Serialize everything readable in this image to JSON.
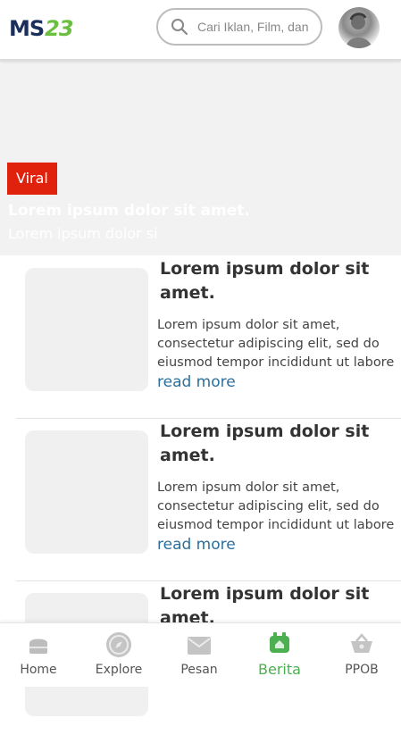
{
  "header": {
    "logo_text_ms": "MS",
    "logo_text_num": "23",
    "search_placeholder": "Cari Iklan, Film, dan"
  },
  "hero": {
    "badge": "Viral",
    "title": "Lorem ipsum dolor sit amet.",
    "subtitle": "Lorem ipsum dolor si"
  },
  "news": [
    {
      "title": "Lorem ipsum dolor sit amet.",
      "body": "Lorem ipsum dolor sit amet, consectetur adipiscing elit, sed do eiusmod tempor incididunt ut labore",
      "link": "read more"
    },
    {
      "title": "Lorem ipsum dolor sit amet.",
      "body": "Lorem ipsum dolor sit amet, consectetur adipiscing elit, sed do eiusmod tempor incididunt ut labore",
      "link": "read more"
    },
    {
      "title": "Lorem ipsum dolor sit amet.",
      "body": "",
      "link": ""
    }
  ],
  "nav": {
    "items": [
      {
        "label": "Home",
        "icon": "home-icon"
      },
      {
        "label": "Explore",
        "icon": "compass-icon"
      },
      {
        "label": "Pesan",
        "icon": "mail-icon"
      },
      {
        "label": "Berita",
        "icon": "news-icon"
      },
      {
        "label": "PPOB",
        "icon": "basket-icon"
      }
    ],
    "active": "Berita",
    "active_color": "#4caf50"
  },
  "colors": {
    "badge": "#e0220c",
    "link": "#2b6f9e",
    "logo_ms": "#1b2f5c",
    "logo_num": "#6abf3f"
  }
}
